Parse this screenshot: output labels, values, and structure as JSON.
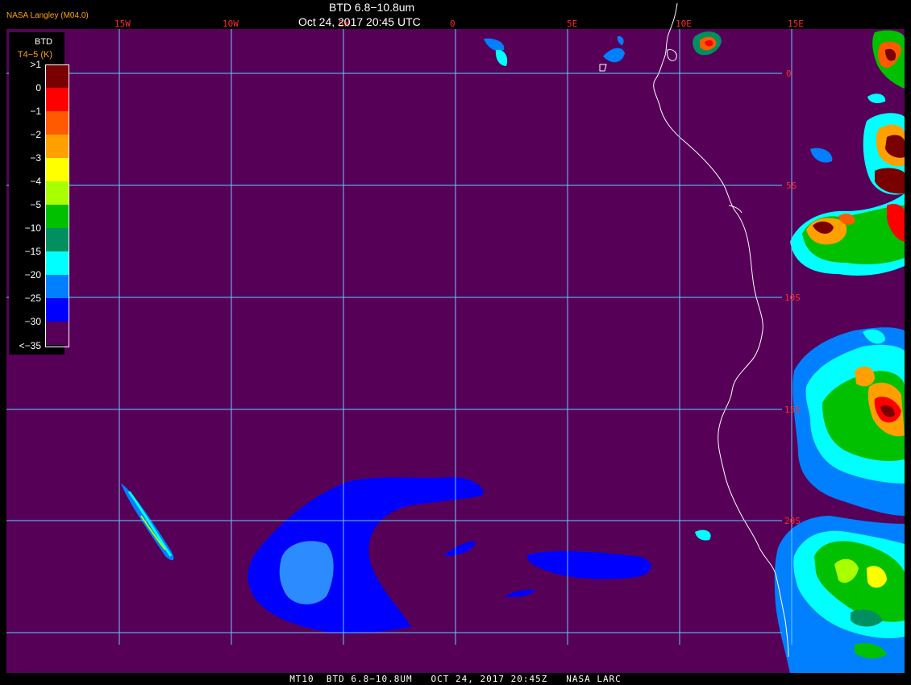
{
  "header": {
    "product": "BTD 6.8−10.8um",
    "datetime": "Oct 24, 2017 20:45 UTC",
    "credit": "NASA Langley (M04.0)"
  },
  "legend": {
    "title": "BTD",
    "units": "T4−5 (K)",
    "entries": [
      {
        "label": ">1",
        "color": "#7a0000"
      },
      {
        "label": "0",
        "color": "#ff0000"
      },
      {
        "label": "−1",
        "color": "#ff5a00"
      },
      {
        "label": "−2",
        "color": "#ffa000"
      },
      {
        "label": "−3",
        "color": "#ffff00"
      },
      {
        "label": "−4",
        "color": "#a8ff00"
      },
      {
        "label": "−5",
        "color": "#00c000"
      },
      {
        "label": "−10",
        "color": "#009060"
      },
      {
        "label": "−15",
        "color": "#00ffff"
      },
      {
        "label": "−20",
        "color": "#0080ff"
      },
      {
        "label": "−25",
        "color": "#0000ff"
      },
      {
        "label": "−30",
        "color": "#560058"
      }
    ],
    "bottom_label": "<−35"
  },
  "grid": {
    "lon_labels": [
      "15W",
      "10W",
      "5W",
      "0",
      "5E",
      "10E",
      "15E"
    ],
    "lat_labels": [
      "0",
      "5S",
      "10S",
      "15S",
      "20S"
    ]
  },
  "colors": {
    "background": "#560058",
    "grid": "#66ccff",
    "coast": "#ffffff",
    "grid_label": "#ff2a2a"
  },
  "footer": {
    "text": "MT10  BTD 6.8−10.8UM   OCT 24, 2017 20:45Z   NASA LARC"
  }
}
